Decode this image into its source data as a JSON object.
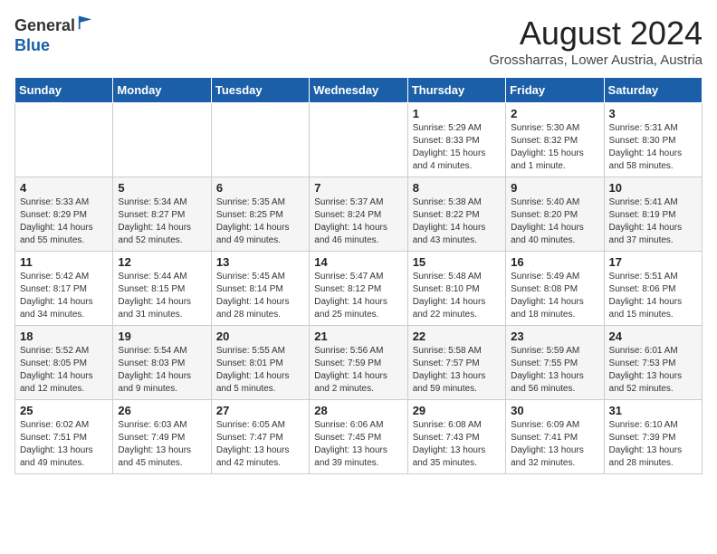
{
  "header": {
    "logo_line1": "General",
    "logo_line2": "Blue",
    "month_title": "August 2024",
    "location": "Grossharras, Lower Austria, Austria"
  },
  "weekdays": [
    "Sunday",
    "Monday",
    "Tuesday",
    "Wednesday",
    "Thursday",
    "Friday",
    "Saturday"
  ],
  "weeks": [
    [
      {
        "day": "",
        "info": ""
      },
      {
        "day": "",
        "info": ""
      },
      {
        "day": "",
        "info": ""
      },
      {
        "day": "",
        "info": ""
      },
      {
        "day": "1",
        "info": "Sunrise: 5:29 AM\nSunset: 8:33 PM\nDaylight: 15 hours\nand 4 minutes."
      },
      {
        "day": "2",
        "info": "Sunrise: 5:30 AM\nSunset: 8:32 PM\nDaylight: 15 hours\nand 1 minute."
      },
      {
        "day": "3",
        "info": "Sunrise: 5:31 AM\nSunset: 8:30 PM\nDaylight: 14 hours\nand 58 minutes."
      }
    ],
    [
      {
        "day": "4",
        "info": "Sunrise: 5:33 AM\nSunset: 8:29 PM\nDaylight: 14 hours\nand 55 minutes."
      },
      {
        "day": "5",
        "info": "Sunrise: 5:34 AM\nSunset: 8:27 PM\nDaylight: 14 hours\nand 52 minutes."
      },
      {
        "day": "6",
        "info": "Sunrise: 5:35 AM\nSunset: 8:25 PM\nDaylight: 14 hours\nand 49 minutes."
      },
      {
        "day": "7",
        "info": "Sunrise: 5:37 AM\nSunset: 8:24 PM\nDaylight: 14 hours\nand 46 minutes."
      },
      {
        "day": "8",
        "info": "Sunrise: 5:38 AM\nSunset: 8:22 PM\nDaylight: 14 hours\nand 43 minutes."
      },
      {
        "day": "9",
        "info": "Sunrise: 5:40 AM\nSunset: 8:20 PM\nDaylight: 14 hours\nand 40 minutes."
      },
      {
        "day": "10",
        "info": "Sunrise: 5:41 AM\nSunset: 8:19 PM\nDaylight: 14 hours\nand 37 minutes."
      }
    ],
    [
      {
        "day": "11",
        "info": "Sunrise: 5:42 AM\nSunset: 8:17 PM\nDaylight: 14 hours\nand 34 minutes."
      },
      {
        "day": "12",
        "info": "Sunrise: 5:44 AM\nSunset: 8:15 PM\nDaylight: 14 hours\nand 31 minutes."
      },
      {
        "day": "13",
        "info": "Sunrise: 5:45 AM\nSunset: 8:14 PM\nDaylight: 14 hours\nand 28 minutes."
      },
      {
        "day": "14",
        "info": "Sunrise: 5:47 AM\nSunset: 8:12 PM\nDaylight: 14 hours\nand 25 minutes."
      },
      {
        "day": "15",
        "info": "Sunrise: 5:48 AM\nSunset: 8:10 PM\nDaylight: 14 hours\nand 22 minutes."
      },
      {
        "day": "16",
        "info": "Sunrise: 5:49 AM\nSunset: 8:08 PM\nDaylight: 14 hours\nand 18 minutes."
      },
      {
        "day": "17",
        "info": "Sunrise: 5:51 AM\nSunset: 8:06 PM\nDaylight: 14 hours\nand 15 minutes."
      }
    ],
    [
      {
        "day": "18",
        "info": "Sunrise: 5:52 AM\nSunset: 8:05 PM\nDaylight: 14 hours\nand 12 minutes."
      },
      {
        "day": "19",
        "info": "Sunrise: 5:54 AM\nSunset: 8:03 PM\nDaylight: 14 hours\nand 9 minutes."
      },
      {
        "day": "20",
        "info": "Sunrise: 5:55 AM\nSunset: 8:01 PM\nDaylight: 14 hours\nand 5 minutes."
      },
      {
        "day": "21",
        "info": "Sunrise: 5:56 AM\nSunset: 7:59 PM\nDaylight: 14 hours\nand 2 minutes."
      },
      {
        "day": "22",
        "info": "Sunrise: 5:58 AM\nSunset: 7:57 PM\nDaylight: 13 hours\nand 59 minutes."
      },
      {
        "day": "23",
        "info": "Sunrise: 5:59 AM\nSunset: 7:55 PM\nDaylight: 13 hours\nand 56 minutes."
      },
      {
        "day": "24",
        "info": "Sunrise: 6:01 AM\nSunset: 7:53 PM\nDaylight: 13 hours\nand 52 minutes."
      }
    ],
    [
      {
        "day": "25",
        "info": "Sunrise: 6:02 AM\nSunset: 7:51 PM\nDaylight: 13 hours\nand 49 minutes."
      },
      {
        "day": "26",
        "info": "Sunrise: 6:03 AM\nSunset: 7:49 PM\nDaylight: 13 hours\nand 45 minutes."
      },
      {
        "day": "27",
        "info": "Sunrise: 6:05 AM\nSunset: 7:47 PM\nDaylight: 13 hours\nand 42 minutes."
      },
      {
        "day": "28",
        "info": "Sunrise: 6:06 AM\nSunset: 7:45 PM\nDaylight: 13 hours\nand 39 minutes."
      },
      {
        "day": "29",
        "info": "Sunrise: 6:08 AM\nSunset: 7:43 PM\nDaylight: 13 hours\nand 35 minutes."
      },
      {
        "day": "30",
        "info": "Sunrise: 6:09 AM\nSunset: 7:41 PM\nDaylight: 13 hours\nand 32 minutes."
      },
      {
        "day": "31",
        "info": "Sunrise: 6:10 AM\nSunset: 7:39 PM\nDaylight: 13 hours\nand 28 minutes."
      }
    ]
  ]
}
